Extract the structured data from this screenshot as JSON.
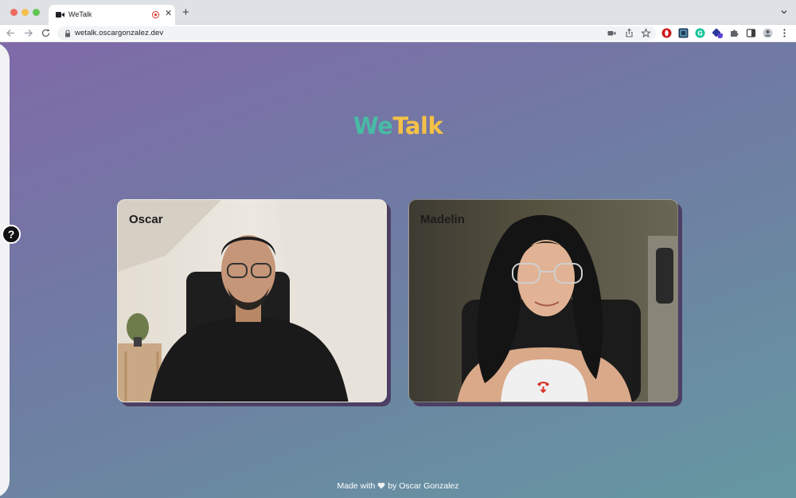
{
  "browser": {
    "tab_title": "WeTalk",
    "url": "wetalk.oscargonzalez.dev",
    "new_tab_glyph": "+",
    "close_glyph": "✕",
    "icons": [
      "back-icon",
      "forward-icon",
      "reload-icon",
      "lock-icon",
      "camera-icon",
      "share-icon",
      "star-icon",
      "opera-icon",
      "extension-icon",
      "grammarly-icon",
      "puzzle-icon",
      "sidebar-icon",
      "profile-icon",
      "more-icon"
    ]
  },
  "app": {
    "logo_part1": "We",
    "logo_part2": "Talk",
    "help_glyph": "?",
    "participants": [
      {
        "name": "Oscar"
      },
      {
        "name": "Madelin"
      }
    ],
    "footer_prefix": "Made with",
    "footer_suffix": "by Oscar Gonzalez",
    "colors": {
      "logo_we": "#48bba4",
      "logo_talk": "#f5c146",
      "card_shadow": "#4d3f63",
      "hangup": "#d93025"
    }
  }
}
